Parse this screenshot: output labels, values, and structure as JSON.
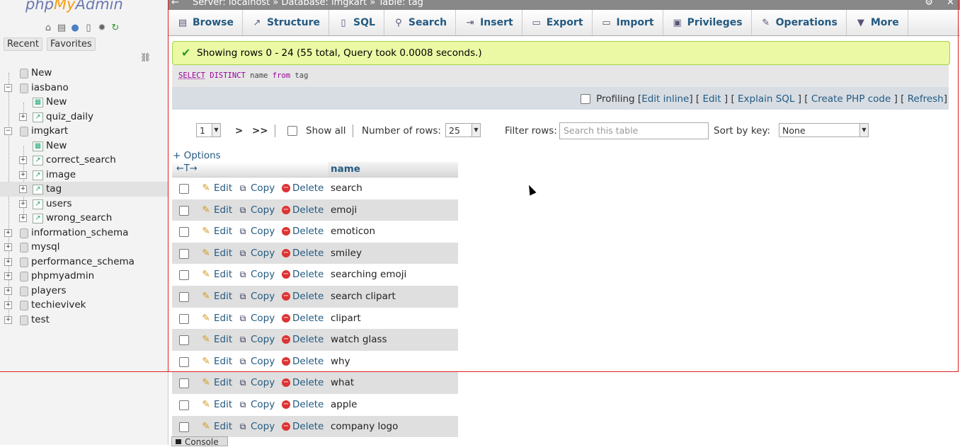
{
  "nav": {
    "logo_php": "php",
    "logo_my": "My",
    "logo_admin": "Admin",
    "tabs": [
      "Recent",
      "Favorites"
    ],
    "icons": [
      "home-icon",
      "sql-window-icon",
      "help-icon",
      "docs-icon",
      "settings-icon",
      "reload-icon"
    ],
    "tree": [
      {
        "label": "New"
      },
      {
        "label": "iasbano"
      },
      {
        "label": "New"
      },
      {
        "label": "quiz_daily"
      },
      {
        "label": "imgkart"
      },
      {
        "label": "New"
      },
      {
        "label": "correct_search"
      },
      {
        "label": "image"
      },
      {
        "label": "tag"
      },
      {
        "label": "users"
      },
      {
        "label": "wrong_search"
      },
      {
        "label": "information_schema"
      },
      {
        "label": "mysql"
      },
      {
        "label": "performance_schema"
      },
      {
        "label": "phpmyadmin"
      },
      {
        "label": "players"
      },
      {
        "label": "techievivek"
      },
      {
        "label": "test"
      }
    ]
  },
  "breadcrumb": {
    "back": "←",
    "text": "Server: localhost » Database: imgkart » Table: tag"
  },
  "tabs": [
    "Browse",
    "Structure",
    "SQL",
    "Search",
    "Insert",
    "Export",
    "Import",
    "Privileges",
    "Operations",
    "More"
  ],
  "message": "Showing rows 0 - 24 (55 total, Query took 0.0008 seconds.)",
  "sql": {
    "select": "SELECT",
    "distinct": "DISTINCT",
    "col": "name",
    "from": "from",
    "table": "tag"
  },
  "profiling": {
    "label": "Profiling",
    "edit_inline": "Edit inline",
    "edit": "Edit",
    "explain": "Explain SQL",
    "php": "Create PHP code",
    "refresh": "Refresh"
  },
  "pager": {
    "page": "1",
    "next": ">",
    "last": ">>",
    "show_all": "Show all",
    "num_rows_label": "Number of rows:",
    "num_rows": "25",
    "filter_label": "Filter rows:",
    "filter_placeholder": "Search this table",
    "sort_label": "Sort by key:",
    "sort_value": "None"
  },
  "options_link": "+ Options",
  "table": {
    "column": "name",
    "actions": {
      "edit": "Edit",
      "copy": "Copy",
      "delete": "Delete"
    },
    "rows": [
      "search",
      "emoji",
      "emoticon",
      "smiley",
      "searching emoji",
      "search clipart",
      "clipart",
      "watch glass",
      "why",
      "what",
      "apple",
      "company logo"
    ]
  },
  "console": "Console"
}
